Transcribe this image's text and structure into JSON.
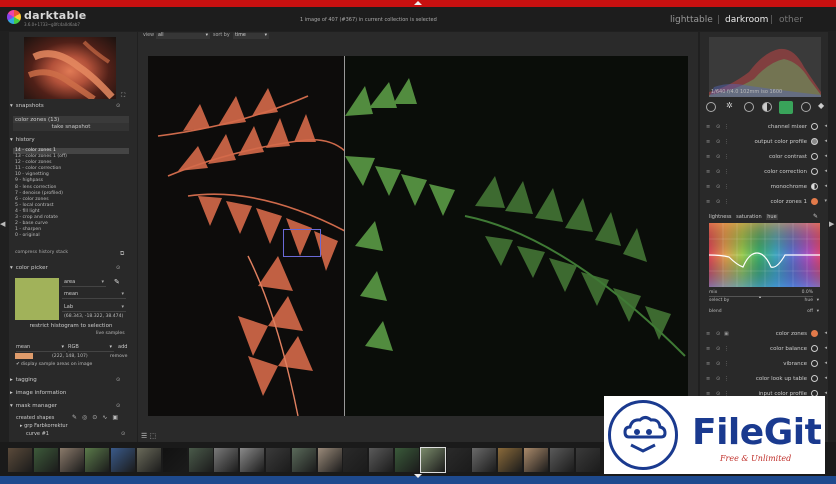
{
  "app": {
    "name": "darktable",
    "version": "3.6.0+1733~g0fc4a0d6ab7",
    "info": "1 image of 407 (#367) in current collection is selected",
    "views": [
      "lighttable",
      "|",
      "darkroom",
      "|",
      "other"
    ]
  },
  "left": {
    "snapshots": {
      "title": "snapshots",
      "item": "color zones (13)",
      "take_label": "take snapshot"
    },
    "history": {
      "title": "history",
      "items": [
        "14 - color zones 1",
        "13 - color zones 1 (off)",
        "12 - color zones",
        "11 - color correction",
        "10 - vignetting",
        "9 - highpass",
        "8 - lens correction",
        "7 - denoise (profiled)",
        "6 - color zones",
        "5 - local contrast",
        "4 - fill light",
        "3 - crop and rotate",
        "2 - base curve",
        "1 - sharpen",
        "0 - original"
      ],
      "compress_label": "compress history stack"
    },
    "color_picker": {
      "title": "color picker",
      "mode": "area",
      "stat": "mean",
      "space": "Lab",
      "values": "(68.343, -18.322, 38.474)",
      "restrict_label": "restrict histogram to selection",
      "live_label": "live samples",
      "sample_stat": "mean",
      "sample_space": "RGB",
      "add_label": "add",
      "sample_values": "(222, 148, 107)",
      "remove_label": "remove",
      "display_label": "display sample areas on image",
      "swatch_color": "#a1b25a",
      "sample_color": "#de9b6b"
    },
    "tagging": {
      "title": "tagging"
    },
    "image_info": {
      "title": "image information"
    },
    "mask_manager": {
      "title": "mask manager",
      "created_shapes": "created shapes",
      "group": "grp Farbkorrektur",
      "curve": "curve #1"
    }
  },
  "center": {
    "view_label": "view",
    "view_value": "all",
    "sort_label": "sort by",
    "sort_value": "time"
  },
  "right": {
    "exif": "1/640 f/4.0 102mm iso 1600",
    "modules": [
      {
        "name": "channel mixer",
        "power": "power-icon",
        "state": "knob"
      },
      {
        "name": "output color profile",
        "power": "power-icon",
        "state": "knob"
      },
      {
        "name": "color contrast",
        "power": "power-icon",
        "state": "circle"
      },
      {
        "name": "color correction",
        "power": "power-icon",
        "state": "circle"
      },
      {
        "name": "monochrome",
        "power": "power-icon",
        "state": "half"
      },
      {
        "name": "color zones 1",
        "power": "power-icon",
        "state": "color"
      }
    ],
    "cz_tabs": [
      "lightness",
      "saturation",
      "hue"
    ],
    "cz_mix_label": "mix",
    "cz_mix_value": "0.0%",
    "cz_select_label": "select by",
    "cz_select_value": "hue",
    "cz_blend_label": "blend",
    "cz_blend_value": "off",
    "modules_after": [
      {
        "name": "color zones",
        "state": "color"
      },
      {
        "name": "color balance",
        "state": "circle"
      },
      {
        "name": "vibrance",
        "state": "circle"
      },
      {
        "name": "color look up table",
        "state": "circle"
      },
      {
        "name": "input color profile",
        "state": "circle"
      }
    ]
  },
  "filmstrip": {
    "colors": [
      "#5a4a3a",
      "#3d5a3a",
      "#8a7a6a",
      "#5a7a4a",
      "#3a5a8a",
      "#6a6a5a",
      "#111111",
      "#4a5a4a",
      "#7a7a7a",
      "#8a8a8a",
      "#3a3a3a",
      "#5a6a5a",
      "#9a8a7a",
      "#2a2a2a",
      "#5a5a5a",
      "#3a5a3a",
      "#7a8a6a",
      "#2a2a2a",
      "#6a6a6a",
      "#8a6a3a",
      "#aa8a6a",
      "#5a5a5a",
      "#3a3a3a"
    ]
  },
  "watermark": {
    "name": "FileGit",
    "tagline": "Free & Unlimited"
  }
}
